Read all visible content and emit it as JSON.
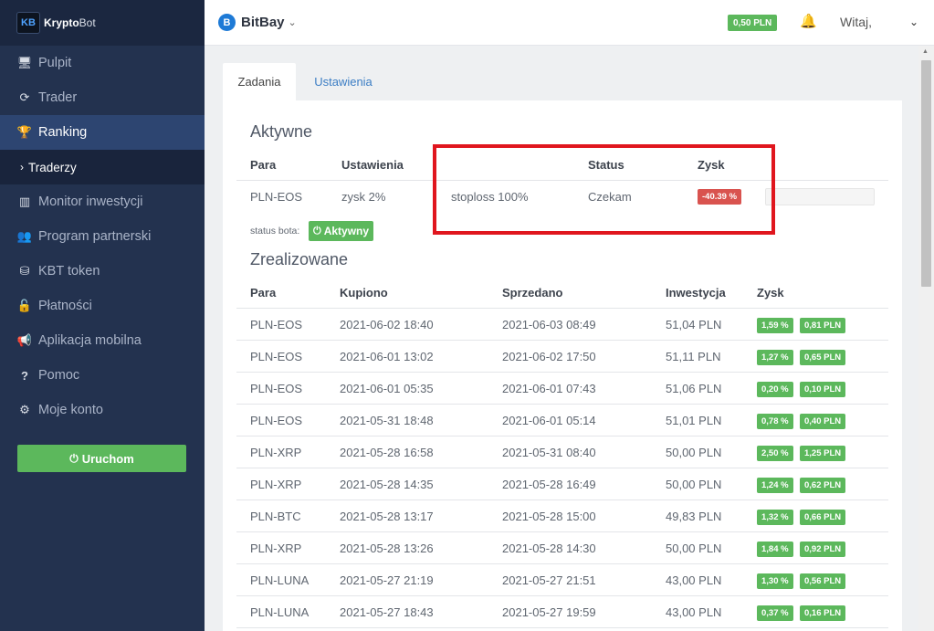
{
  "brand": {
    "logo": "KB",
    "name_bold": "Krypto",
    "name_thin": "Bot"
  },
  "sidebar": {
    "items": [
      {
        "label": "Pulpit",
        "icon": "monitor-icon",
        "glyph": "🖥"
      },
      {
        "label": "Trader",
        "icon": "refresh-icon",
        "glyph": "⟳"
      },
      {
        "label": "Ranking",
        "icon": "trophy-icon",
        "glyph": "🏆",
        "active": true
      },
      {
        "label": "Monitor inwestycji",
        "icon": "bar-chart-icon",
        "glyph": "▥"
      },
      {
        "label": "Program partnerski",
        "icon": "users-icon",
        "glyph": "👥"
      },
      {
        "label": "KBT token",
        "icon": "coins-icon",
        "glyph": "⛁"
      },
      {
        "label": "Płatności",
        "icon": "unlock-icon",
        "glyph": "🔓"
      },
      {
        "label": "Aplikacja mobilna",
        "icon": "bullhorn-icon",
        "glyph": "📢"
      },
      {
        "label": "Pomoc",
        "icon": "question-icon",
        "glyph": "?"
      },
      {
        "label": "Moje konto",
        "icon": "cogs-icon",
        "glyph": "⚙"
      }
    ],
    "sub_item": "Traderzy",
    "start_button": "Uruchom"
  },
  "topbar": {
    "exchange_logo": "B",
    "exchange": "BitBay",
    "balance": "0,50 PLN",
    "greeting": "Witaj,"
  },
  "tabs": [
    {
      "label": "Zadania",
      "active": true
    },
    {
      "label": "Ustawienia",
      "active": false
    }
  ],
  "active_section": {
    "title": "Aktywne",
    "headers": {
      "pair": "Para",
      "settings": "Ustawienia",
      "status": "Status",
      "profit": "Zysk"
    },
    "row": {
      "pair": "PLN-EOS",
      "settings": "zysk 2%",
      "stoploss": "stoploss 100%",
      "status": "Czekam",
      "profit": "-40.39 %",
      "progress": 0.0
    },
    "bot_status_label": "status bota:",
    "bot_status": "Aktywny"
  },
  "realized_section": {
    "title": "Zrealizowane",
    "headers": {
      "pair": "Para",
      "bought": "Kupiono",
      "sold": "Sprzedano",
      "investment": "Inwestycja",
      "profit": "Zysk"
    },
    "rows": [
      {
        "pair": "PLN-EOS",
        "bought": "2021-06-02 18:40",
        "sold": "2021-06-03 08:49",
        "investment": "51,04 PLN",
        "profit_pct": "1,59 %",
        "profit_pln": "0,81 PLN"
      },
      {
        "pair": "PLN-EOS",
        "bought": "2021-06-01 13:02",
        "sold": "2021-06-02 17:50",
        "investment": "51,11 PLN",
        "profit_pct": "1,27 %",
        "profit_pln": "0,65 PLN"
      },
      {
        "pair": "PLN-EOS",
        "bought": "2021-06-01 05:35",
        "sold": "2021-06-01 07:43",
        "investment": "51,06 PLN",
        "profit_pct": "0,20 %",
        "profit_pln": "0,10 PLN"
      },
      {
        "pair": "PLN-EOS",
        "bought": "2021-05-31 18:48",
        "sold": "2021-06-01 05:14",
        "investment": "51,01 PLN",
        "profit_pct": "0,78 %",
        "profit_pln": "0,40 PLN"
      },
      {
        "pair": "PLN-XRP",
        "bought": "2021-05-28 16:58",
        "sold": "2021-05-31 08:40",
        "investment": "50,00 PLN",
        "profit_pct": "2,50 %",
        "profit_pln": "1,25 PLN"
      },
      {
        "pair": "PLN-XRP",
        "bought": "2021-05-28 14:35",
        "sold": "2021-05-28 16:49",
        "investment": "50,00 PLN",
        "profit_pct": "1,24 %",
        "profit_pln": "0,62 PLN"
      },
      {
        "pair": "PLN-BTC",
        "bought": "2021-05-28 13:17",
        "sold": "2021-05-28 15:00",
        "investment": "49,83 PLN",
        "profit_pct": "1,32 %",
        "profit_pln": "0,66 PLN"
      },
      {
        "pair": "PLN-XRP",
        "bought": "2021-05-28 13:26",
        "sold": "2021-05-28 14:30",
        "investment": "50,00 PLN",
        "profit_pct": "1,84 %",
        "profit_pln": "0,92 PLN"
      },
      {
        "pair": "PLN-LUNA",
        "bought": "2021-05-27 21:19",
        "sold": "2021-05-27 21:51",
        "investment": "43,00 PLN",
        "profit_pct": "1,30 %",
        "profit_pln": "0,56 PLN"
      },
      {
        "pair": "PLN-LUNA",
        "bought": "2021-05-27 18:43",
        "sold": "2021-05-27 19:59",
        "investment": "43,00 PLN",
        "profit_pct": "0,37 %",
        "profit_pln": "0,16 PLN"
      }
    ]
  },
  "colors": {
    "sidebar": "#23324f",
    "success": "#5cb85c",
    "danger": "#d9534f",
    "highlight": "#e0161e",
    "link": "#3b7dc4"
  }
}
